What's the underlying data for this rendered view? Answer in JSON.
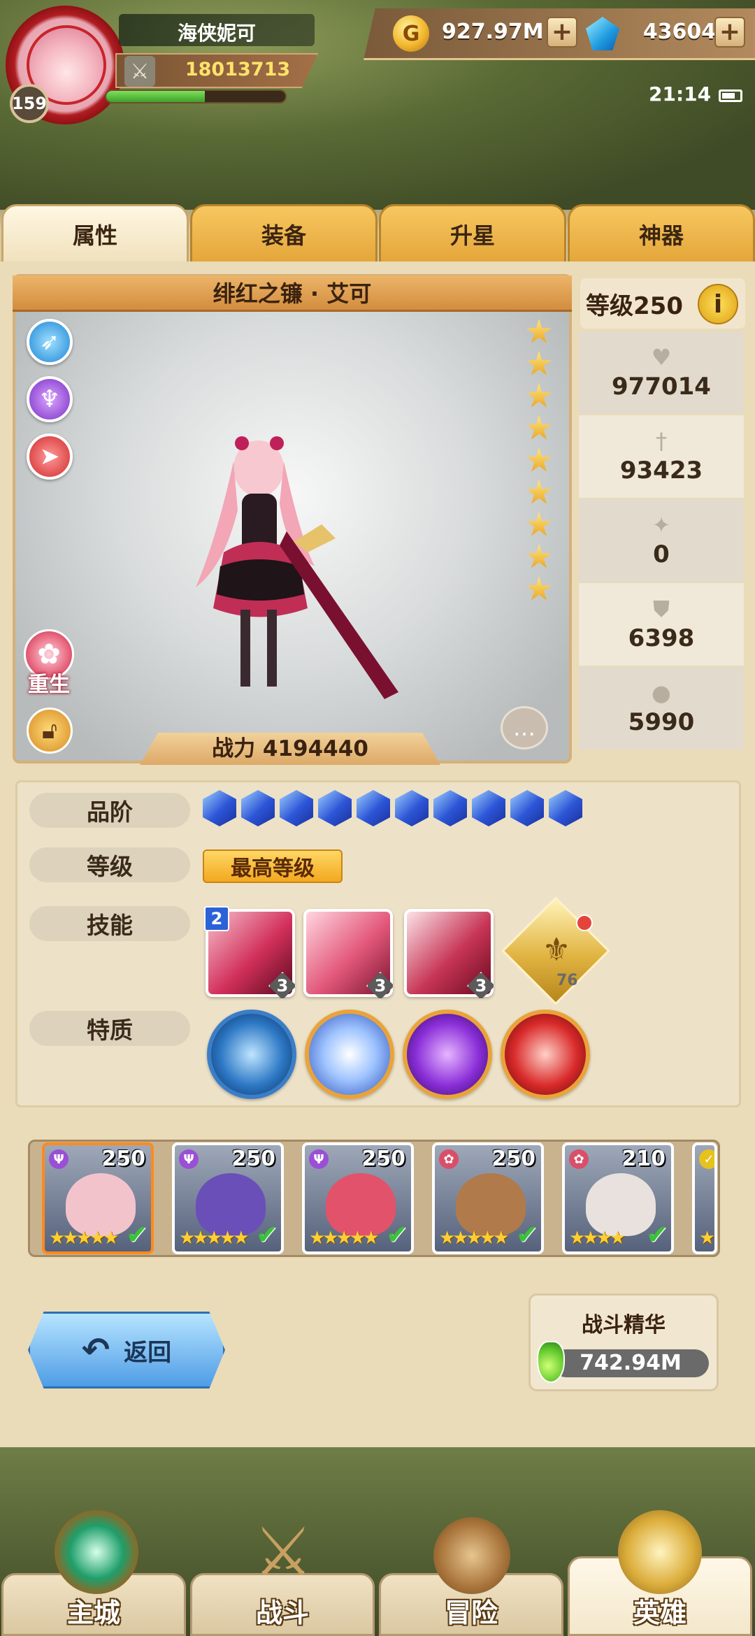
{
  "player": {
    "name": "海侠妮可",
    "level": "159",
    "power": "18013713",
    "exp_fraction": 0.55
  },
  "resources": {
    "gold": "927.97M",
    "gems": "43604",
    "add_label": "+"
  },
  "status_bar": {
    "time": "21:14",
    "battery_icon": "battery-icon"
  },
  "tabs": [
    {
      "label": "属性",
      "active": true
    },
    {
      "label": "装备",
      "active": false
    },
    {
      "label": "升星",
      "active": false
    },
    {
      "label": "神器",
      "active": false
    }
  ],
  "hero": {
    "name": "绯红之镰 · 艾可",
    "stars": 9,
    "combat_power": "战力 4194440",
    "rebirth_label": "重生",
    "class_icons": [
      "wing-icon",
      "demon-icon",
      "rocket-icon"
    ]
  },
  "stats": {
    "level_label": "等级250",
    "info_label": "i",
    "items": [
      {
        "icon": "heart-icon",
        "glyph": "♥",
        "value": "977014"
      },
      {
        "icon": "sword-icon",
        "glyph": "†",
        "value": "93423"
      },
      {
        "icon": "star-burst-icon",
        "glyph": "✦",
        "value": "0"
      },
      {
        "icon": "shield-icon",
        "glyph": "⛊",
        "value": "6398"
      },
      {
        "icon": "drop-icon",
        "glyph": "●",
        "value": "5990"
      }
    ]
  },
  "details": {
    "grade_label": "品阶",
    "grade_gems": 10,
    "level_label": "等级",
    "level_value": "最高等级",
    "skills_label": "技能",
    "skill_badge": "2",
    "skills": [
      {
        "level": "3"
      },
      {
        "level": "3"
      },
      {
        "level": "3"
      }
    ],
    "emblem_value": "76",
    "traits_label": "特质"
  },
  "hero_list": [
    {
      "level": "250",
      "class_color": "#9a4fd6",
      "stars": "★★★★★",
      "face_color": "#f3c3cc"
    },
    {
      "level": "250",
      "class_color": "#9a4fd6",
      "stars": "★★★★★",
      "face_color": "#6b4fb8"
    },
    {
      "level": "250",
      "class_color": "#9a4fd6",
      "stars": "★★★★★",
      "face_color": "#e2526a"
    },
    {
      "level": "250",
      "class_color": "#d94f6a",
      "stars": "★★★★★",
      "face_color": "#b07a4b"
    },
    {
      "level": "210",
      "class_color": "#d94f6a",
      "stars": "★★★★",
      "face_color": "#e8e1dd"
    },
    {
      "level": "",
      "class_color": "#e6c21d",
      "stars": "★",
      "face_color": "#5c7a4a"
    }
  ],
  "actions": {
    "back_label": "返回",
    "essence_title": "战斗精华",
    "essence_value": "742.94M"
  },
  "nav": [
    {
      "label": "主城",
      "active": false
    },
    {
      "label": "战斗",
      "active": false
    },
    {
      "label": "冒险",
      "active": false
    },
    {
      "label": "英雄",
      "active": true
    }
  ],
  "colors": {
    "tab_active": "#f0e1bd",
    "tab_inactive": "#f7c760",
    "accent_gold": "#ffe36a",
    "hero_pink": "#d2305b"
  }
}
